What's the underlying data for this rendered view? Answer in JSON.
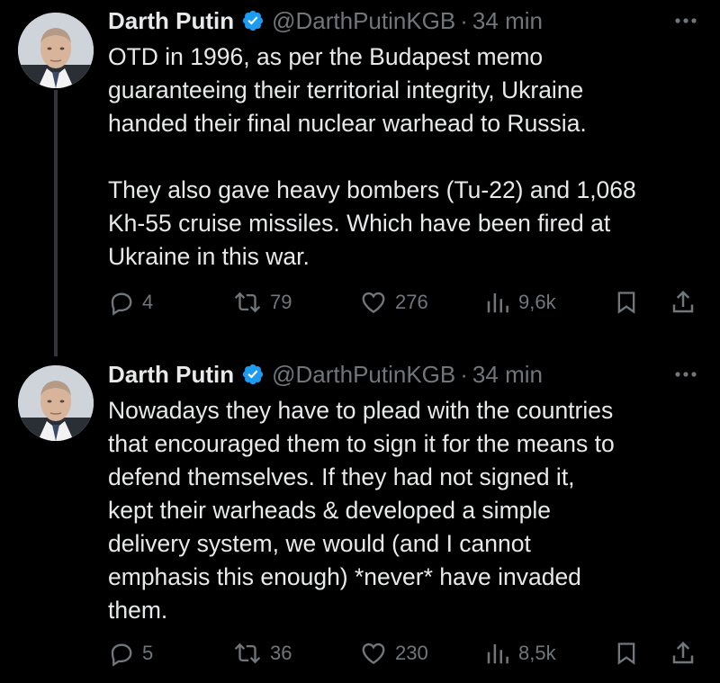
{
  "tweets": [
    {
      "author_name": "Darth Putin",
      "handle": "@DarthPutinKGB",
      "separator": "·",
      "time": "34 min",
      "text": "OTD in 1996, as per the Budapest memo\nguaranteeing their territorial integrity, Ukraine\nhanded their final nuclear warhead to Russia.\n\nThey also gave heavy bombers (Tu-22) and 1,068\nKh-55 cruise missiles. Which have been fired at\nUkraine in this war.",
      "replies": "4",
      "reposts": "79",
      "likes": "276",
      "views": "9,6k"
    },
    {
      "author_name": "Darth Putin",
      "handle": "@DarthPutinKGB",
      "separator": "·",
      "time": "34 min",
      "text": "Nowadays they have to plead with the countries\nthat encouraged them to sign it for the means to\ndefend themselves. If they had not signed it,\nkept their warheads & developed a simple\ndelivery system, we would (and I cannot\nemphasis this enough) *never* have invaded\nthem.",
      "replies": "5",
      "reposts": "36",
      "likes": "230",
      "views": "8,5k"
    }
  ],
  "icons": {
    "verified": "verified-badge-icon",
    "more": "more-horizontal-icon",
    "reply": "reply-icon",
    "repost": "repost-icon",
    "like": "heart-icon",
    "views": "views-chart-icon",
    "bookmark": "bookmark-icon",
    "share": "share-icon"
  },
  "colors": {
    "background": "#000000",
    "text": "#e7e9ea",
    "muted": "#71767b",
    "verified": "#1d9bf0",
    "thread_line": "#333639"
  }
}
